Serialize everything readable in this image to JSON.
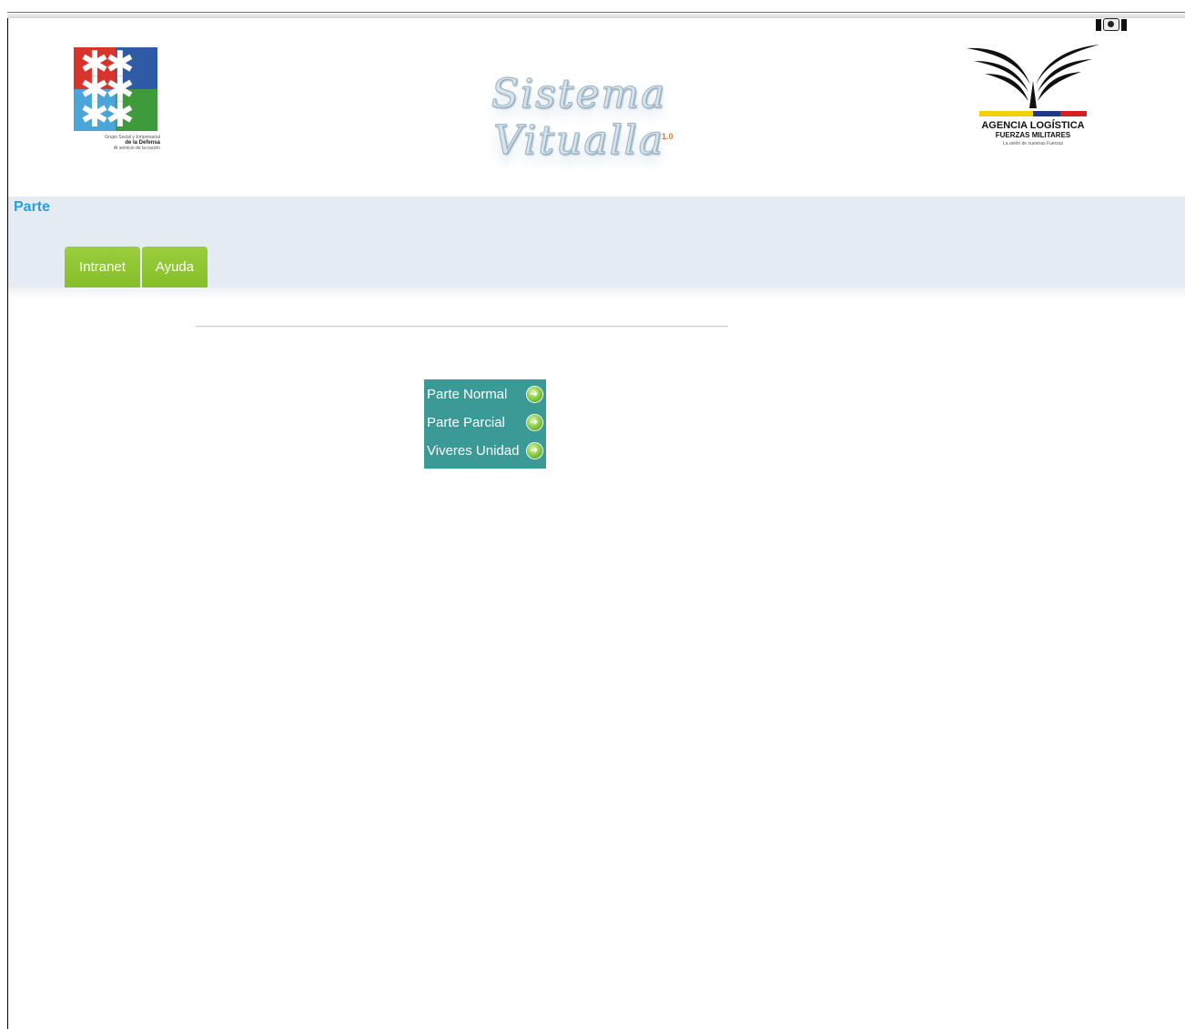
{
  "header": {
    "app_title": "Sistema Vitualla",
    "version": "1.0",
    "left_logo": {
      "caption_line1": "Grupo Social y Empresarial",
      "caption_line2": "de la Defensa",
      "caption_line3": "Al servicio de la nación"
    },
    "right_logo": {
      "name_line1": "AGENCIA LOGÍSTICA",
      "name_line2": "FUERZAS MILITARES",
      "motto": "La unión de nuestras Fuerzas"
    }
  },
  "section": {
    "title": "Parte"
  },
  "tabs": [
    {
      "label": "Intranet"
    },
    {
      "label": "Ayuda"
    }
  ],
  "menu": {
    "items": [
      {
        "label": "Parte Normal",
        "icon": "arrow-right-circle-icon"
      },
      {
        "label": "Parte Parcial",
        "icon": "arrow-right-circle-icon"
      },
      {
        "label": "Viveres Unidad",
        "icon": "arrow-right-circle-icon"
      }
    ]
  },
  "colors": {
    "band": "#e4ebf2",
    "tab_green": "#8cc432",
    "menu_teal": "#3b9a96",
    "section_title_blue": "#2a9fd6",
    "version_orange": "#e8752a"
  }
}
